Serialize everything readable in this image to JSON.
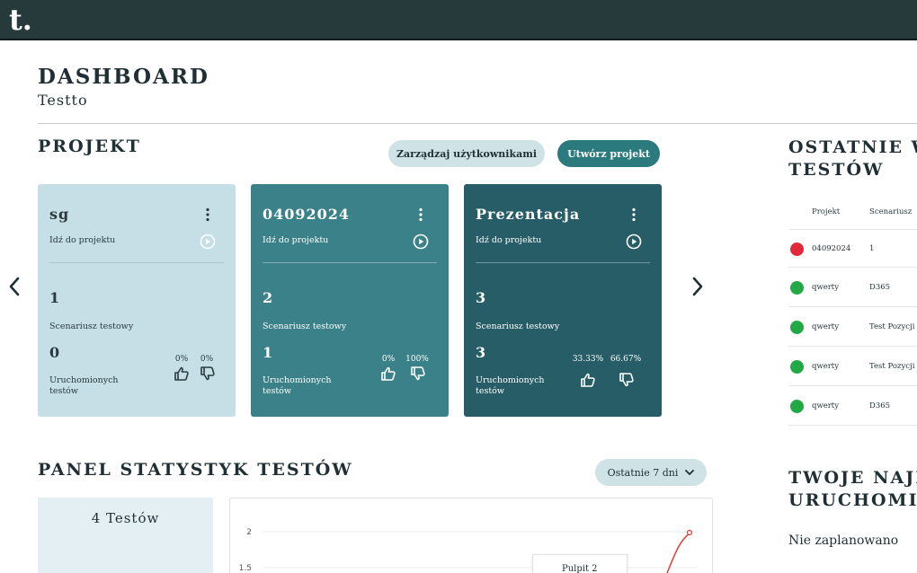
{
  "app": {
    "logo": "t."
  },
  "header": {
    "title": "DASHBOARD",
    "subtitle": "Testto"
  },
  "projects": {
    "section_title": "PROJEKT",
    "manage_users_label": "Zarządzaj użytkownikami",
    "create_project_label": "Utwórz projekt",
    "cards": [
      {
        "name": "sg",
        "goto": "Idź do projektu",
        "scenarios_count": "1",
        "scenarios_label": "Scenariusz testowy",
        "runs_count": "0",
        "runs_label": "Uruchomionych testów",
        "pass_pct": "0%",
        "fail_pct": "0%"
      },
      {
        "name": "04092024",
        "goto": "Idź do projektu",
        "scenarios_count": "2",
        "scenarios_label": "Scenariusz testowy",
        "runs_count": "1",
        "runs_label": "Uruchomionych testów",
        "pass_pct": "0%",
        "fail_pct": "100%"
      },
      {
        "name": "Prezentacja",
        "goto": "Idź do projektu",
        "scenarios_count": "3",
        "scenarios_label": "Scenariusz testowy",
        "runs_count": "3",
        "runs_label": "Uruchomionych testów",
        "pass_pct": "33.33%",
        "fail_pct": "66.67%"
      }
    ]
  },
  "recent_runs": {
    "title_line1": "OSTATNIE W",
    "title_line2": "TESTÓW",
    "col_project": "Projekt",
    "col_scenario": "Scenariusz",
    "rows": [
      {
        "status": "failed",
        "project": "04092024",
        "scenario": "1"
      },
      {
        "status": "passed",
        "project": "qwerty",
        "scenario": "D365"
      },
      {
        "status": "passed",
        "project": "qwerty",
        "scenario": "Test Pozycji"
      },
      {
        "status": "passed",
        "project": "qwerty",
        "scenario": "Test Pozycji"
      },
      {
        "status": "passed",
        "project": "qwerty",
        "scenario": "D365"
      }
    ]
  },
  "stats": {
    "title": "PANEL STATYSTYK TESTÓW",
    "filter_label": "Ostatnie 7 dni",
    "total_label": "4 Testów",
    "tooltip_label": "Pulpit 2"
  },
  "chart_data": {
    "type": "line",
    "y_ticks": [
      "2",
      "1.5"
    ],
    "series": [
      {
        "color": "#e53935",
        "trend": "rising"
      }
    ]
  },
  "upcoming": {
    "title_line1": "TWOJE NAJB",
    "title_line2": "URUCHOMIE",
    "empty_text": "Nie zaplanowano"
  },
  "colors": {
    "topbar": "#26393b",
    "card_light": "#c6dfe6",
    "card_mid": "#3a8189",
    "card_dark": "#265d67",
    "accent_button": "#2b7a7e",
    "status_passed": "#22a845",
    "status_failed": "#e0283a"
  }
}
